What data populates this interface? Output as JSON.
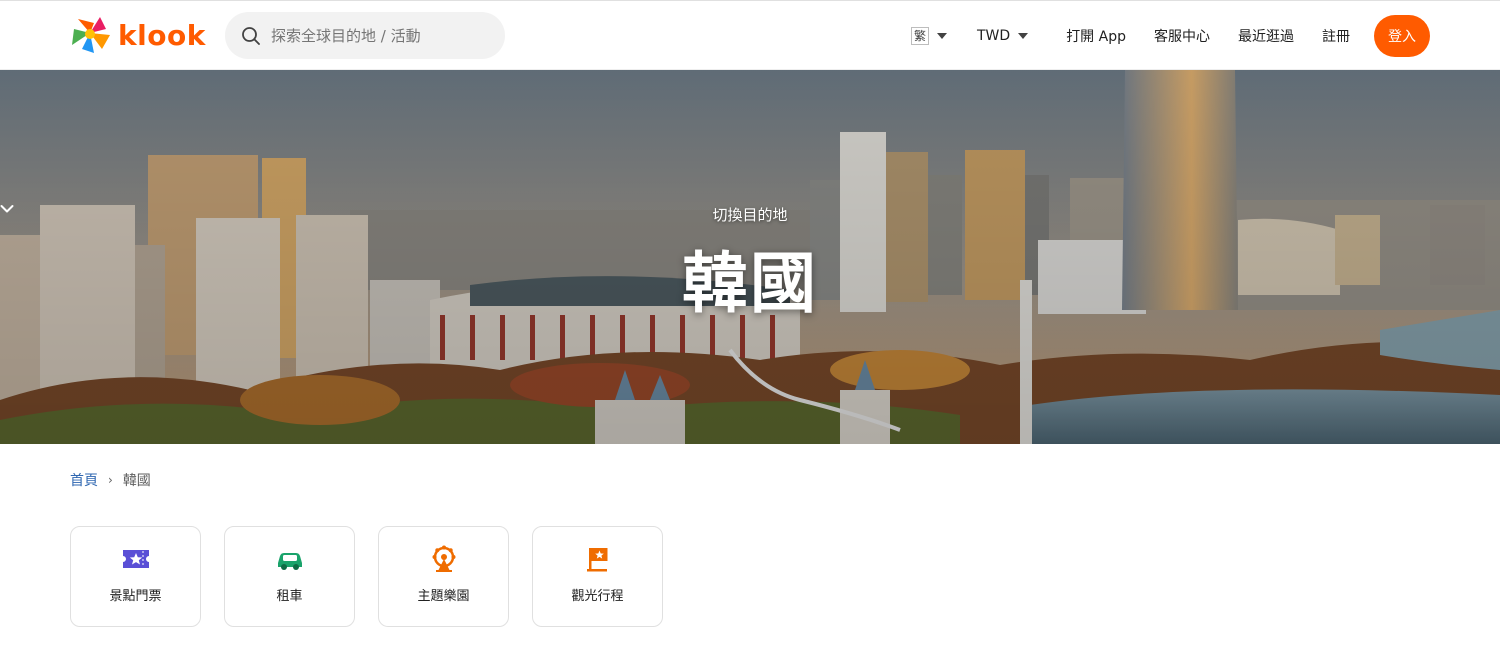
{
  "header": {
    "logo_text": "klook",
    "search_placeholder": "探索全球目的地 / 活動",
    "lang_label": "繁",
    "currency_label": "TWD",
    "open_app_label": "打開 App",
    "help_label": "客服中心",
    "recent_label": "最近逛過",
    "signup_label": "註冊",
    "login_label": "登入",
    "brand_color": "#ff5b00"
  },
  "hero": {
    "switch_label": "切換目的地",
    "title": "韓國"
  },
  "breadcrumb": {
    "home": "首頁",
    "separator": "›",
    "current": "韓國"
  },
  "categories": [
    {
      "label": "景點門票",
      "icon": "ticket-icon",
      "color": "#5a4fd6"
    },
    {
      "label": "租車",
      "icon": "car-icon",
      "color": "#1aa36b"
    },
    {
      "label": "主題樂園",
      "icon": "ferris-wheel-icon",
      "color": "#ef6c00"
    },
    {
      "label": "觀光行程",
      "icon": "flag-icon",
      "color": "#ef6c00"
    }
  ]
}
